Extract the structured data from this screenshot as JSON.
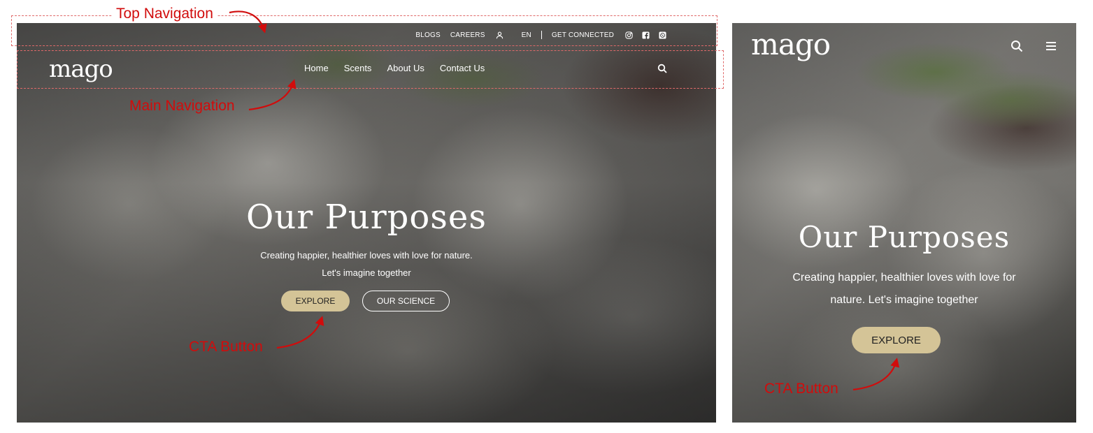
{
  "desktop": {
    "top_nav": {
      "blogs": "BLOGS",
      "careers": "CAREERS",
      "language": "EN",
      "get_connected": "GET CONNECTED"
    },
    "logo": "mago",
    "main_nav": [
      "Home",
      "Scents",
      "About Us",
      "Contact Us"
    ],
    "hero": {
      "title": "Our Purposes",
      "subtitle_line1": "Creating happier, healthier loves with love for nature.",
      "subtitle_line2": "Let's imagine together"
    },
    "buttons": {
      "explore": "EXPLORE",
      "our_science": "OUR SCIENCE"
    }
  },
  "mobile": {
    "logo": "mago",
    "hero": {
      "title": "Our Purposes",
      "subtitle": "Creating happier, healthier loves with love for nature. Let's imagine together"
    },
    "buttons": {
      "explore": "EXPLORE"
    }
  },
  "annotations": {
    "top_navigation": "Top Navigation",
    "main_navigation": "Main Navigation",
    "cta_button_desktop": "CTA Button",
    "cta_button_mobile": "CTA Button"
  },
  "colors": {
    "cta_fill": "#d4c497",
    "annotation_red": "#d10c0c"
  },
  "icons": [
    "user-icon",
    "instagram-icon",
    "facebook-icon",
    "whatsapp-icon",
    "search-icon",
    "hamburger-menu-icon"
  ]
}
